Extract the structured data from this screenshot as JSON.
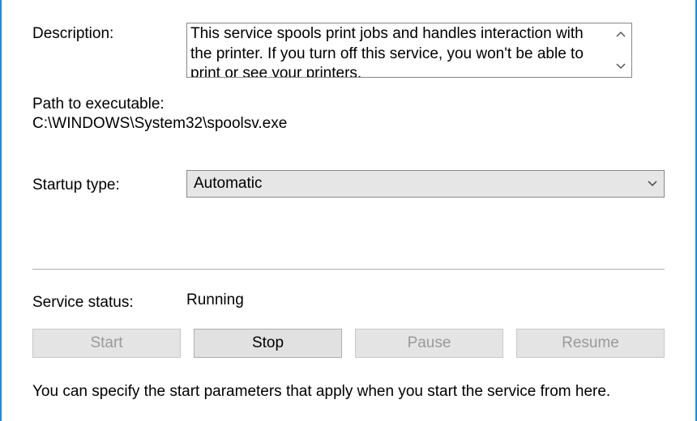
{
  "labels": {
    "description": "Description:",
    "path_to_executable": "Path to executable:",
    "startup_type": "Startup type:",
    "service_status": "Service status:"
  },
  "description_text": "This service spools print jobs and handles interaction with the printer.  If you turn off this service, you won't be able to print or see your printers.",
  "executable_path": "C:\\WINDOWS\\System32\\spoolsv.exe",
  "startup_type_value": "Automatic",
  "service_status_value": "Running",
  "buttons": {
    "start": "Start",
    "stop": "Stop",
    "pause": "Pause",
    "resume": "Resume"
  },
  "button_states": {
    "start": "disabled",
    "stop": "enabled",
    "pause": "disabled",
    "resume": "disabled"
  },
  "hint": "You can specify the start parameters that apply when you start the service from here."
}
